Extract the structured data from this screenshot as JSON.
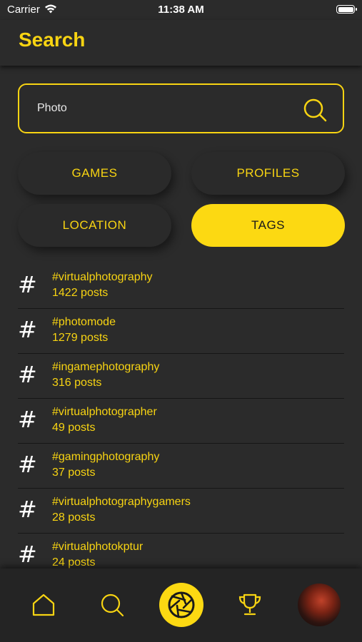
{
  "status_bar": {
    "carrier": "Carrier",
    "time": "11:38 AM"
  },
  "header": {
    "title": "Search"
  },
  "search": {
    "value": "Photo"
  },
  "filters": {
    "games": "GAMES",
    "profiles": "PROFILES",
    "location": "LOCATION",
    "tags": "TAGS",
    "selected": "TAGS"
  },
  "tags": [
    {
      "name": "#virtualphotography",
      "count": "1422 posts"
    },
    {
      "name": "#photomode",
      "count": "1279 posts"
    },
    {
      "name": "#ingamephotography",
      "count": "316 posts"
    },
    {
      "name": "#virtualphotographer",
      "count": "49 posts"
    },
    {
      "name": "#gamingphotography",
      "count": "37 posts"
    },
    {
      "name": "#virtualphotographygamers",
      "count": "28 posts"
    },
    {
      "name": "#virtualphotokptur",
      "count": "24 posts"
    }
  ],
  "tag_symbol": "#",
  "tab_bar": {
    "items": [
      {
        "icon": "home-icon"
      },
      {
        "icon": "search-icon"
      },
      {
        "icon": "camera-aperture-icon"
      },
      {
        "icon": "trophy-icon"
      },
      {
        "icon": "profile-avatar"
      }
    ],
    "active": "camera-aperture-icon"
  },
  "colors": {
    "accent": "#f8d412",
    "background": "#2b2b2b",
    "tab_bar": "#242424"
  }
}
